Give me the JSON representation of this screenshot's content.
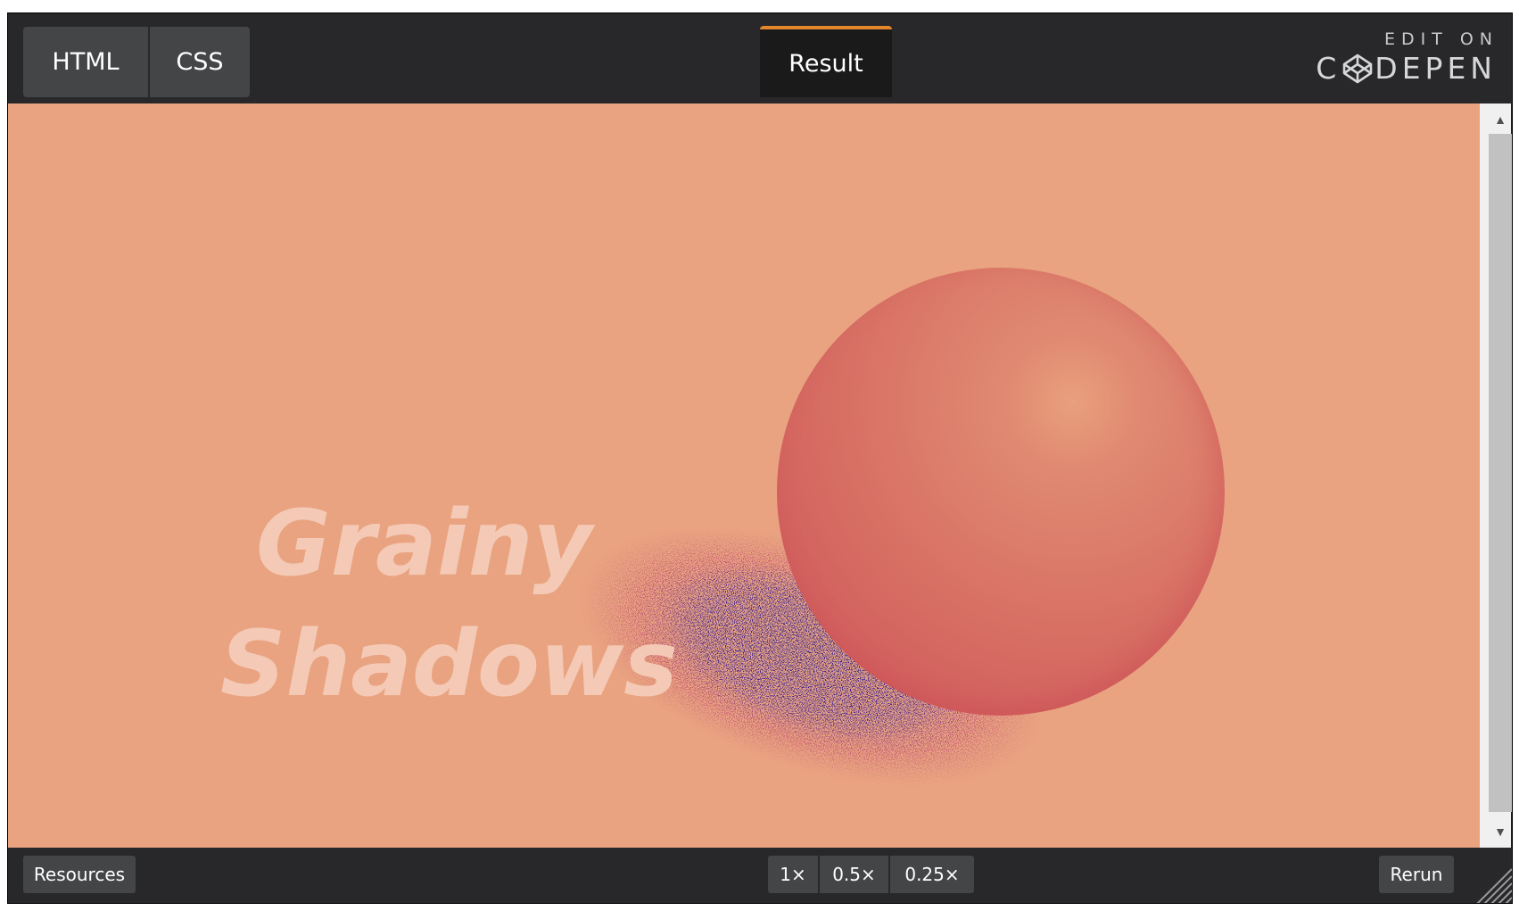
{
  "header": {
    "tabs": {
      "html_label": "HTML",
      "css_label": "CSS",
      "result_label": "Result"
    },
    "edit_on_label": "EDIT ON",
    "brand_label_left": "C",
    "brand_label_right": "DEPEN",
    "brand_icon": "codepen-logo-icon"
  },
  "result": {
    "title_line_1": "Grainy",
    "title_line_2": "Shadows",
    "colors": {
      "background": "#e9a381",
      "sphere": "#d66a62",
      "shadow": "#2a1a8a",
      "text": "#f5cdb9"
    }
  },
  "footer": {
    "resources_label": "Resources",
    "zoom_options": [
      "1×",
      "0.5×",
      "0.25×"
    ],
    "rerun_label": "Rerun"
  },
  "colors": {
    "chrome_bg": "#28282a",
    "button_bg": "#444547",
    "active_accent": "#e3862b"
  }
}
